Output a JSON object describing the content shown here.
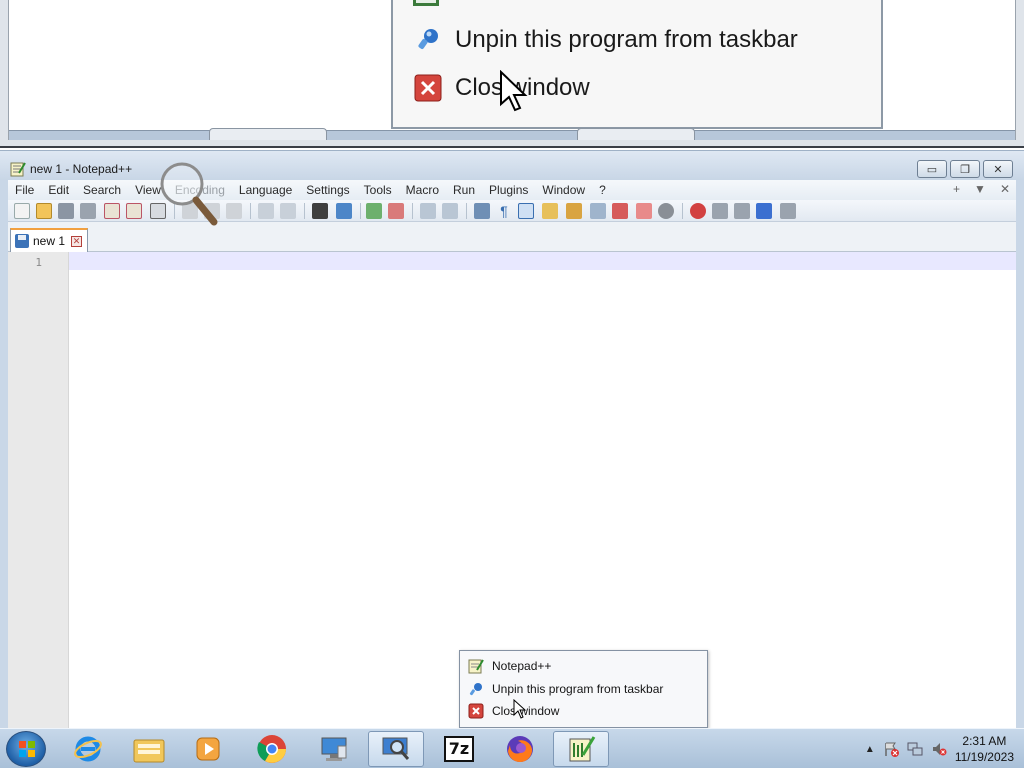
{
  "magnifier": {
    "menu_items": [
      {
        "label": "Unpin this program from taskbar",
        "icon": "pin-icon"
      },
      {
        "label": "Clos  window",
        "icon": "close-window-icon"
      }
    ]
  },
  "window": {
    "title": "new 1 - Notepad++",
    "controls": {
      "minimize": "▭",
      "restore": "❐",
      "close": "✕"
    }
  },
  "menubar": {
    "items": [
      "File",
      "Edit",
      "Search",
      "View",
      "Encoding",
      "Language",
      "Settings",
      "Tools",
      "Macro",
      "Run",
      "Plugins",
      "Window",
      "?"
    ],
    "right": [
      "+",
      "▼",
      "✕"
    ]
  },
  "tabs": [
    {
      "label": "new 1",
      "active": true
    }
  ],
  "editor": {
    "line_numbers": [
      "1"
    ]
  },
  "jumplist": {
    "items": [
      {
        "label": "Notepad++",
        "icon": "notepad-plus-plus-icon"
      },
      {
        "label": "Unpin this program from taskbar",
        "icon": "pin-icon"
      },
      {
        "label": "Clos  window",
        "icon": "close-window-icon"
      }
    ]
  },
  "taskbar": {
    "apps": [
      {
        "name": "internet-explorer-icon"
      },
      {
        "name": "file-explorer-icon"
      },
      {
        "name": "media-player-icon"
      },
      {
        "name": "chrome-icon"
      },
      {
        "name": "remote-desktop-icon"
      },
      {
        "name": "magnifier-icon",
        "active": true
      },
      {
        "name": "7zip-icon",
        "text": "7z"
      },
      {
        "name": "firefox-icon"
      },
      {
        "name": "notepad-plus-plus-icon",
        "active": true
      }
    ],
    "tray": {
      "time": "2:31 AM",
      "date": "11/19/2023"
    }
  },
  "colors": {
    "accent_tab": "#f2a03f",
    "current_line": "#e8e8ff",
    "taskbar": "#b7cde3"
  }
}
